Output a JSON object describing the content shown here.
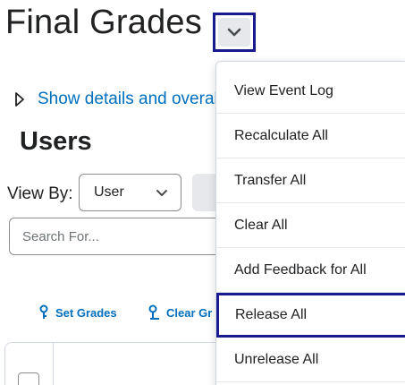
{
  "header": {
    "title": "Final Grades",
    "dropdown_icon": "chevron-down-icon"
  },
  "details": {
    "icon": "triangle-right-icon",
    "link_text": "Show details and overall"
  },
  "users": {
    "heading": "Users",
    "view_by_label": "View By:",
    "view_by_value": "User",
    "search_placeholder": "Search For..."
  },
  "toolbar": {
    "set_grades_label": "Set Grades",
    "clear_label": "Clear Gr"
  },
  "menu": {
    "items": [
      "View Event Log",
      "Recalculate All",
      "Transfer All",
      "Clear All",
      "Add Feedback for All",
      "Release All",
      "Unrelease All"
    ],
    "highlighted": "Release All"
  },
  "colors": {
    "link": "#006fbf",
    "highlight_border": "#1a1a8f",
    "text": "#202122"
  }
}
